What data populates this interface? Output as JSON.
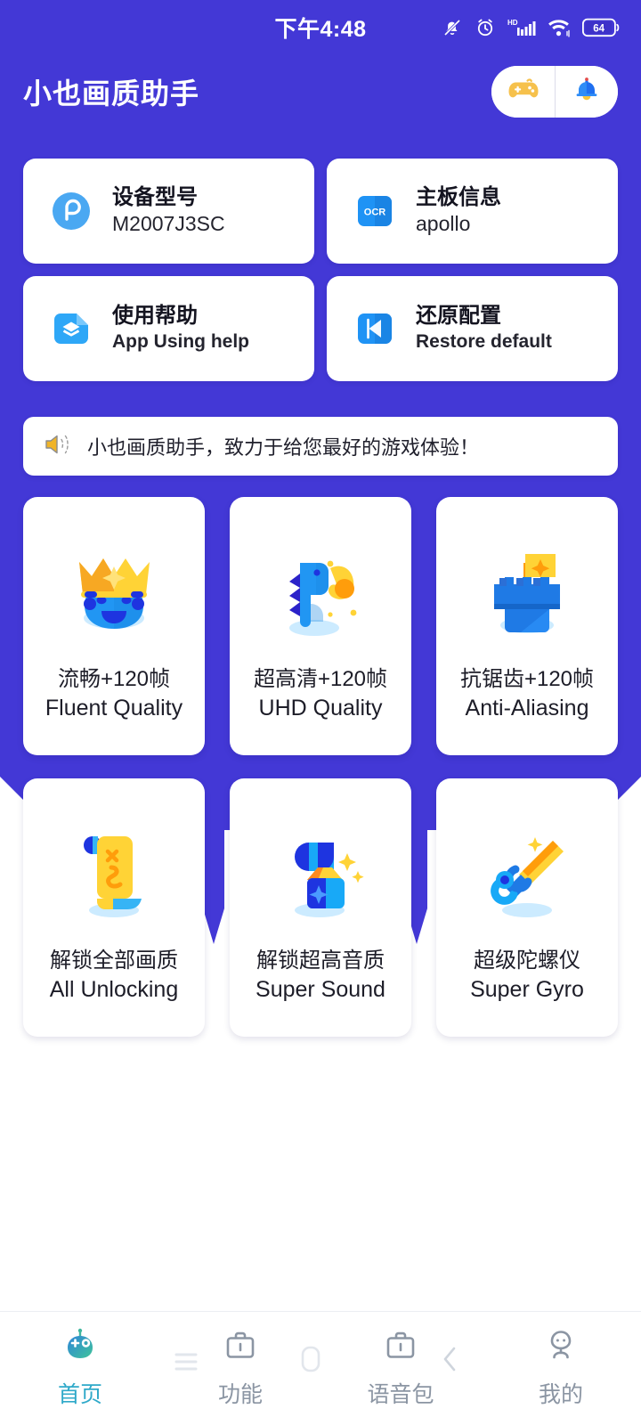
{
  "status_bar": {
    "time": "下午4:48",
    "icons": [
      "bell-muted-icon",
      "alarm-clock-icon",
      "hd-signal-icon",
      "wifi-icon",
      "battery-icon"
    ],
    "battery_level": "64"
  },
  "header": {
    "title": "小也画质助手",
    "actions": [
      {
        "name": "gamepad-button",
        "icon": "gamepad-icon"
      },
      {
        "name": "notification-button",
        "icon": "bell-icon"
      }
    ]
  },
  "info_cards": [
    {
      "icon": "device-icon",
      "title": "设备型号",
      "value": "M2007J3SC",
      "value_en": false
    },
    {
      "icon": "ocr-icon",
      "title": "主板信息",
      "value": "apollo",
      "value_en": false
    },
    {
      "icon": "layers-icon",
      "title": "使用帮助",
      "value": "App Using help",
      "value_en": true
    },
    {
      "icon": "restore-icon",
      "title": "还原配置",
      "value": "Restore default",
      "value_en": true
    }
  ],
  "notice": {
    "icon": "speaker-icon",
    "text": "小也画质助手，致力于给您最好的游戏体验！"
  },
  "features": [
    {
      "icon": "crown-face-icon",
      "cn": "流畅+120帧",
      "en": "Fluent Quality"
    },
    {
      "icon": "dino-icon",
      "cn": "超高清+120帧",
      "en": "UHD Quality"
    },
    {
      "icon": "castle-flag-icon",
      "cn": "抗锯齿+120帧",
      "en": "Anti-Aliasing"
    },
    {
      "icon": "scroll-icon",
      "cn": "解锁全部画质",
      "en": "All Unlocking"
    },
    {
      "icon": "gift-box-icon",
      "cn": "解锁超高音质",
      "en": "Super Sound"
    },
    {
      "icon": "sword-icon",
      "cn": "超级陀螺仪",
      "en": "Super Gyro"
    }
  ],
  "bottom_nav": {
    "items": [
      {
        "icon": "robot-home-icon",
        "label": "首页",
        "active": true
      },
      {
        "icon": "briefcase-icon",
        "label": "功能",
        "active": false
      },
      {
        "icon": "voicepack-icon",
        "label": "语音包",
        "active": false
      },
      {
        "icon": "person-icon",
        "label": "我的",
        "active": false
      }
    ]
  },
  "system_nav": {
    "icons": [
      "menu-icon",
      "home-pill-icon",
      "back-chevron-icon"
    ]
  },
  "colors": {
    "brand_purple": "#4338d6",
    "card_white": "#ffffff",
    "accent_yellow": "#f9c22b",
    "accent_blue": "#1f93f5",
    "active_tab": "#2fa9c9",
    "inactive_tab": "#8b95a3"
  }
}
